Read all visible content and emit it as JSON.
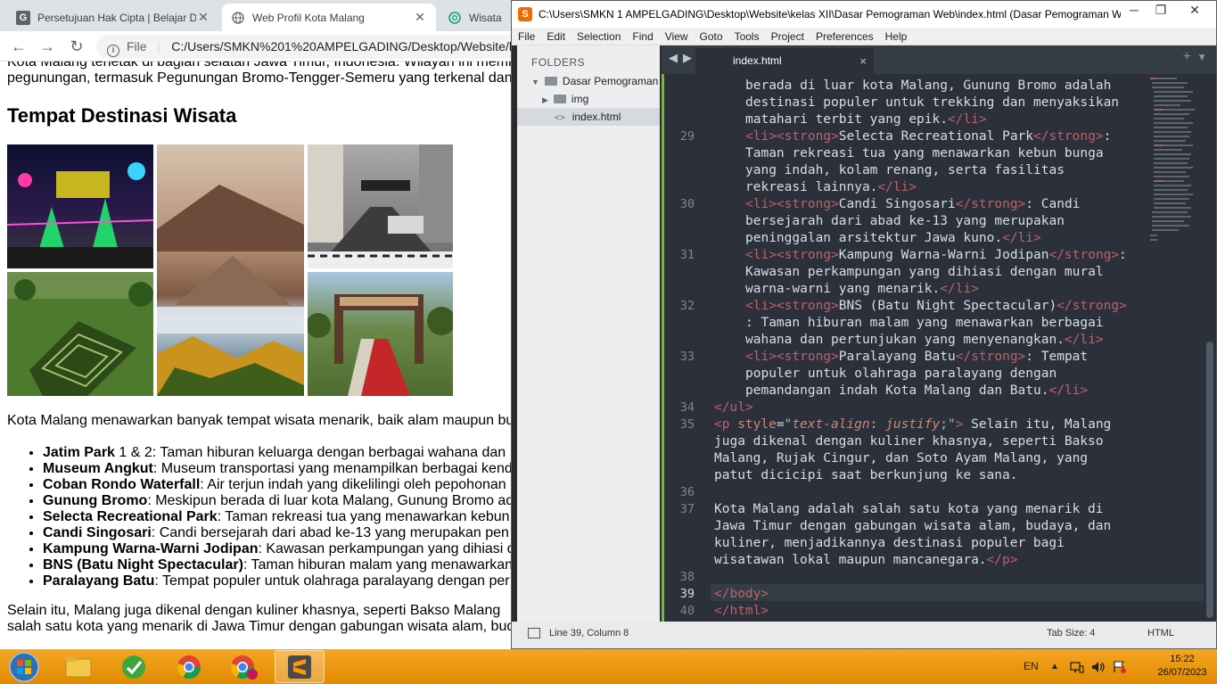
{
  "browser": {
    "tabs": [
      {
        "title": "Persetujuan Hak Cipta | Belajar D",
        "icon": "google-classroom-icon"
      },
      {
        "title": "Web Profil Kota Malang",
        "icon": "globe-icon"
      },
      {
        "title": "Wisata Ko",
        "icon": "chatgpt-icon"
      }
    ],
    "tab_close": "✕",
    "file_label": "File",
    "url": "C:/Users/SMKN%201%20AMPELGADING/Desktop/Website/kela"
  },
  "page": {
    "intro_line1": "Kota Malang terletak di bagian selatan Jawa Timur, Indonesia. Wilayah ini memiliki",
    "intro_line2": "pegunungan, termasuk Pegunungan Bromo-Tengger-Semeru yang terkenal dan",
    "heading": "Tempat Destinasi Wisata",
    "gallery": [
      {
        "name": "bns-night-image",
        "color": "#1b1f3a"
      },
      {
        "name": "bromo-mountain-image",
        "color": "#8a6a55"
      },
      {
        "name": "angkut-museum-image",
        "color": "#7a7a7a"
      },
      {
        "name": "maze-garden-image",
        "color": "#3f6b2c"
      },
      {
        "name": "cretaceous-gate-image",
        "color": "#6b8a4a"
      }
    ],
    "paragraph1": "Kota Malang menawarkan banyak tempat wisata menarik, baik alam maupun bu",
    "list": [
      {
        "bold": "Jatim Park",
        "rest": " 1 & 2: Taman hiburan keluarga dengan berbagai wahana dan"
      },
      {
        "bold": "Museum Angkut",
        "rest": ": Museum transportasi yang menampilkan berbagai kend"
      },
      {
        "bold": "Coban Rondo Waterfall",
        "rest": ": Air terjun indah yang dikelilingi oleh pepohonan"
      },
      {
        "bold": "Gunung Bromo",
        "rest": ": Meskipun berada di luar kota Malang, Gunung Bromo ad"
      },
      {
        "bold": "Selecta Recreational Park",
        "rest": ": Taman rekreasi tua yang menawarkan kebun"
      },
      {
        "bold": "Candi Singosari",
        "rest": ": Candi bersejarah dari abad ke-13 yang merupakan pen"
      },
      {
        "bold": "Kampung Warna-Warni Jodipan",
        "rest": ": Kawasan perkampungan yang dihiasi d"
      },
      {
        "bold": "BNS (Batu Night Spectacular)",
        "rest": ": Taman hiburan malam yang menawarkan"
      },
      {
        "bold": "Paralayang Batu",
        "rest": ": Tempat populer untuk olahraga paralayang dengan per"
      }
    ],
    "paragraph2_line1": "Selain itu, Malang juga dikenal dengan kuliner khasnya, seperti Bakso Malang",
    "paragraph2_line2": "salah satu kota yang menarik di Jawa Timur dengan gabungan wisata alam, bud"
  },
  "editor": {
    "window_title": "C:\\Users\\SMKN 1 AMPELGADING\\Desktop\\Website\\kelas XII\\Dasar Pemograman Web\\index.html (Dasar Pemograman W...",
    "menu": [
      "File",
      "Edit",
      "Selection",
      "Find",
      "View",
      "Goto",
      "Tools",
      "Project",
      "Preferences",
      "Help"
    ],
    "sidebar_header": "FOLDERS",
    "tree": [
      {
        "label": "Dasar Pemograman '",
        "type": "folder-open"
      },
      {
        "label": "img",
        "type": "folder"
      },
      {
        "label": "index.html",
        "type": "file"
      }
    ],
    "tab_label": "index.html",
    "tab_close": "×",
    "status_position": "Line 39, Column 8",
    "tab_size": "Tab Size: 4",
    "syntax": "HTML",
    "line_numbers": [
      "29",
      "30",
      "31",
      "32",
      "33",
      "34",
      "35",
      "36",
      "37",
      "38",
      "39",
      "40"
    ],
    "current_line": "39"
  },
  "taskbar": {
    "language": "EN",
    "time": "15:22",
    "date": "26/07/2023"
  }
}
